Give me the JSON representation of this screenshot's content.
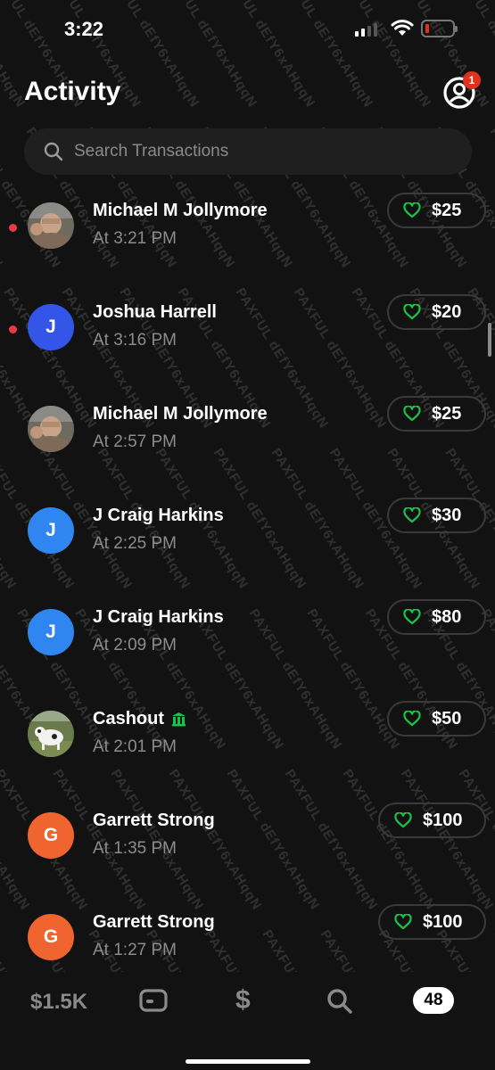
{
  "status_bar": {
    "time": "3:22"
  },
  "header": {
    "title": "Activity",
    "notification_count": "1"
  },
  "search": {
    "placeholder": "Search Transactions"
  },
  "transactions": [
    {
      "name": "Michael M Jollymore",
      "time": "At 3:21 PM",
      "amount": "$25",
      "unread": true,
      "avatar": "photo-man",
      "initial": ""
    },
    {
      "name": "Joshua Harrell",
      "time": "At 3:16 PM",
      "amount": "$20",
      "unread": true,
      "avatar": "initial",
      "initial": "J",
      "color": "#3456e8"
    },
    {
      "name": "Michael M Jollymore",
      "time": "At 2:57 PM",
      "amount": "$25",
      "unread": false,
      "avatar": "photo-man",
      "initial": ""
    },
    {
      "name": "J Craig Harkins",
      "time": "At 2:25 PM",
      "amount": "$30",
      "unread": false,
      "avatar": "initial",
      "initial": "J",
      "color": "#2f86f0"
    },
    {
      "name": "J Craig Harkins",
      "time": "At 2:09 PM",
      "amount": "$80",
      "unread": false,
      "avatar": "initial",
      "initial": "J",
      "color": "#2f86f0"
    },
    {
      "name": "Cashout",
      "time": "At 2:01 PM",
      "amount": "$50",
      "unread": false,
      "avatar": "photo-dog",
      "initial": "",
      "bank_icon": true
    },
    {
      "name": "Garrett Strong",
      "time": "At 1:35 PM",
      "amount": "$100",
      "unread": false,
      "avatar": "initial",
      "initial": "G",
      "color": "#f06430"
    },
    {
      "name": "Garrett Strong",
      "time": "At 1:27 PM",
      "amount": "$100",
      "unread": false,
      "avatar": "initial",
      "initial": "G",
      "color": "#f06430"
    }
  ],
  "tabbar": {
    "balance": "$1.5K",
    "cash": "$",
    "activity_count": "48"
  },
  "colors": {
    "background": "#121212",
    "accent_green": "#19c24a",
    "unread_dot": "#e8394a"
  },
  "watermark": "PAXFUL dEfY6xAHqqN"
}
